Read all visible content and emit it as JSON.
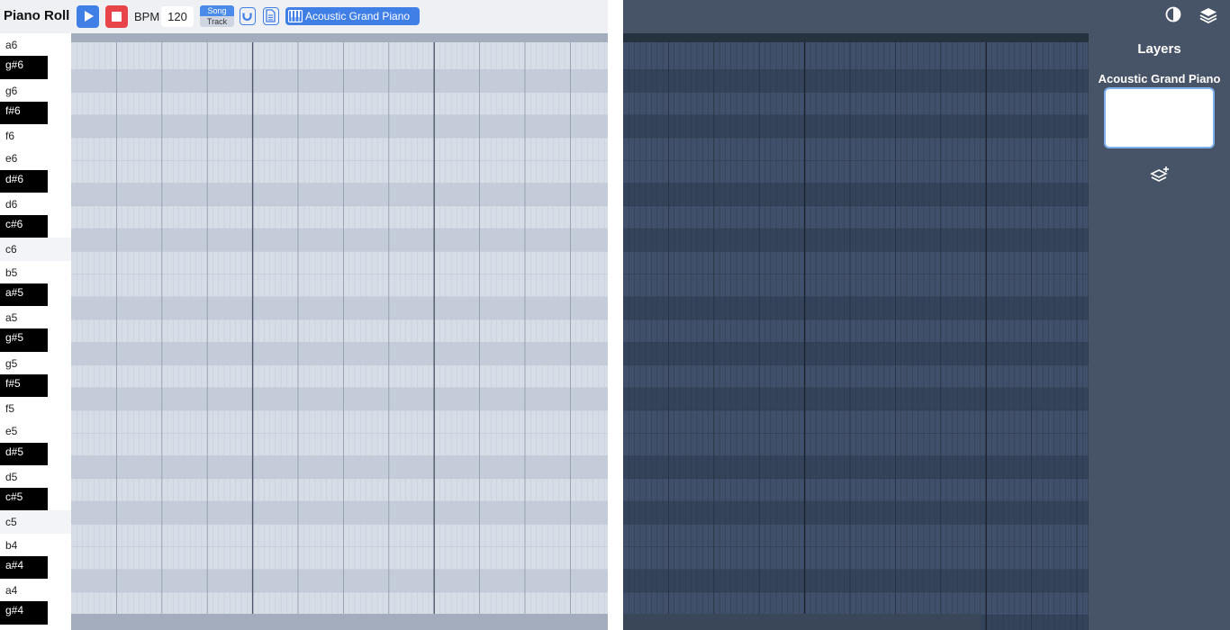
{
  "toolbar": {
    "title": "Piano Roll",
    "play_icon": "play-icon",
    "stop_icon": "stop-icon",
    "bpm_label": "BPM",
    "bpm_value": "120",
    "mode_song": "Song",
    "mode_track": "Track",
    "magnet_icon": "magnet-icon",
    "file_icon": "file-icon",
    "instrument_icon": "piano-icon",
    "instrument_label": "Acoustic Grand Piano",
    "colors": {
      "accent": "#3f7fe6",
      "stop": "#e8454b"
    }
  },
  "keys": [
    {
      "label": "a6",
      "black": false
    },
    {
      "label": "g#6",
      "black": true
    },
    {
      "label": "g6",
      "black": false
    },
    {
      "label": "f#6",
      "black": true
    },
    {
      "label": "f6",
      "black": false
    },
    {
      "label": "e6",
      "black": false
    },
    {
      "label": "d#6",
      "black": true
    },
    {
      "label": "d6",
      "black": false
    },
    {
      "label": "c#6",
      "black": true
    },
    {
      "label": "c6",
      "black": false
    },
    {
      "label": "b5",
      "black": false
    },
    {
      "label": "a#5",
      "black": true
    },
    {
      "label": "a5",
      "black": false
    },
    {
      "label": "g#5",
      "black": true
    },
    {
      "label": "g5",
      "black": false
    },
    {
      "label": "f#5",
      "black": true
    },
    {
      "label": "f5",
      "black": false
    },
    {
      "label": "e5",
      "black": false
    },
    {
      "label": "d#5",
      "black": true
    },
    {
      "label": "d5",
      "black": false
    },
    {
      "label": "c#5",
      "black": true
    },
    {
      "label": "c5",
      "black": false
    },
    {
      "label": "b4",
      "black": false
    },
    {
      "label": "a#4",
      "black": true
    },
    {
      "label": "a4",
      "black": false
    },
    {
      "label": "g#4",
      "black": true
    }
  ],
  "sidebar": {
    "theme_icon": "contrast-icon",
    "layers_icon": "layers-icon",
    "heading": "Layers",
    "layer_name": "Acoustic Grand Piano",
    "add_layer_icon": "add-layer-icon"
  }
}
